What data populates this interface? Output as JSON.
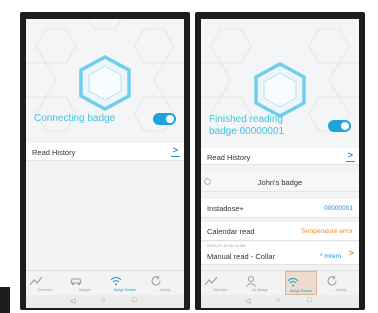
{
  "colors": {
    "accent": "#1fa4d8",
    "hero_text": "#43c3e0",
    "temperature_error": "#f08a24",
    "value_blue": "#1f8fd0"
  },
  "left": {
    "status_text": "Connecting badge",
    "read_history_label": "Read History",
    "nav": [
      {
        "label": "Overview",
        "icon": "chart-line-icon"
      },
      {
        "label": "Badges",
        "icon": "car-icon"
      },
      {
        "label": "Badge Reader",
        "icon": "wifi-icon"
      },
      {
        "label": "Activity",
        "icon": "refresh-icon"
      }
    ]
  },
  "right": {
    "status_line1": "Finished reading",
    "status_line2": "badge 00000001",
    "read_history_label": "Read History",
    "badge_name": "John's badge",
    "instadose_label": "Instadose+",
    "instadose_value": "00000001",
    "calendar_label": "Calendar read",
    "calendar_value": "Temperature error",
    "manual_timestamp": "2019-07-10 10:15 AM",
    "manual_label": "Manual read - Collar",
    "manual_value": "* mrem",
    "nav": [
      {
        "label": "Overview",
        "icon": "chart-line-icon"
      },
      {
        "label": "My Badge",
        "icon": "person-icon"
      },
      {
        "label": "Badge Reader",
        "icon": "wifi-icon"
      },
      {
        "label": "Activity",
        "icon": "refresh-icon"
      }
    ]
  },
  "system_nav": {
    "back": "◁",
    "home": "○",
    "recents": "□"
  }
}
